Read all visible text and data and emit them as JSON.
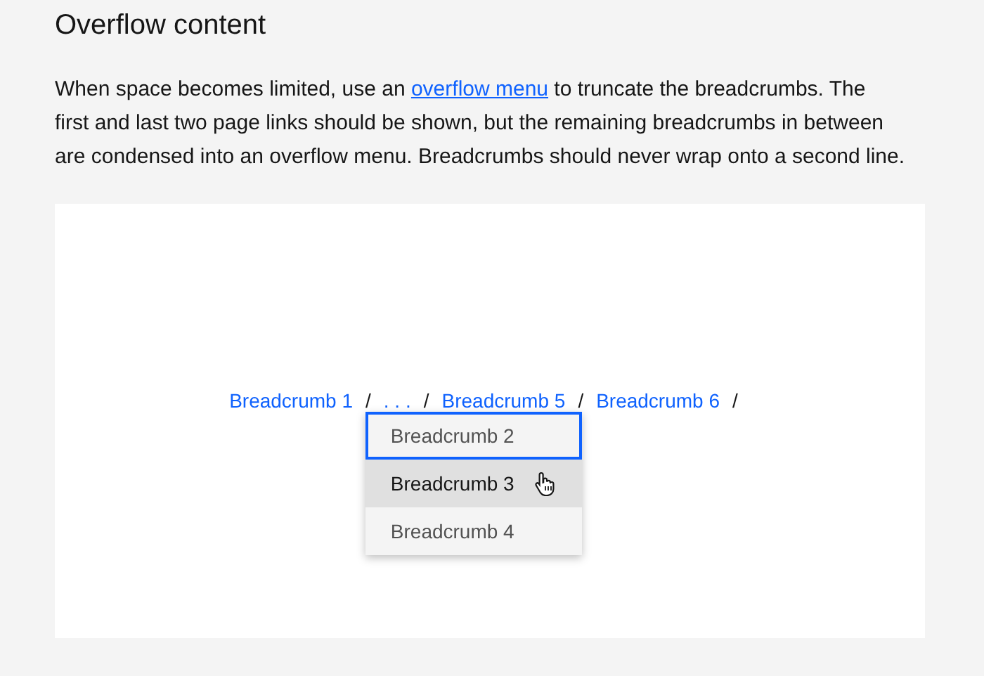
{
  "heading": "Overflow content",
  "paragraph": {
    "before": "When space becomes limited, use an ",
    "link": "overflow menu",
    "after": " to truncate the breadcrumbs. The first and last two page links should be shown, but the remaining breadcrumbs in between are condensed into an overflow menu. Breadcrumbs should never wrap onto a second line."
  },
  "breadcrumb": [
    {
      "kind": "link",
      "label": "Breadcrumb 1",
      "separator": "/"
    },
    {
      "kind": "overflow",
      "label": ". . .",
      "separator": "/",
      "menu": [
        {
          "label": "Breadcrumb 2",
          "focused": true,
          "hovered": false
        },
        {
          "label": "Breadcrumb 3",
          "focused": false,
          "hovered": true
        },
        {
          "label": "Breadcrumb 4",
          "focused": false,
          "hovered": false
        }
      ]
    },
    {
      "kind": "link",
      "label": "Breadcrumb 5",
      "separator": "/"
    },
    {
      "kind": "link",
      "label": "Breadcrumb 6",
      "separator": "/"
    }
  ]
}
